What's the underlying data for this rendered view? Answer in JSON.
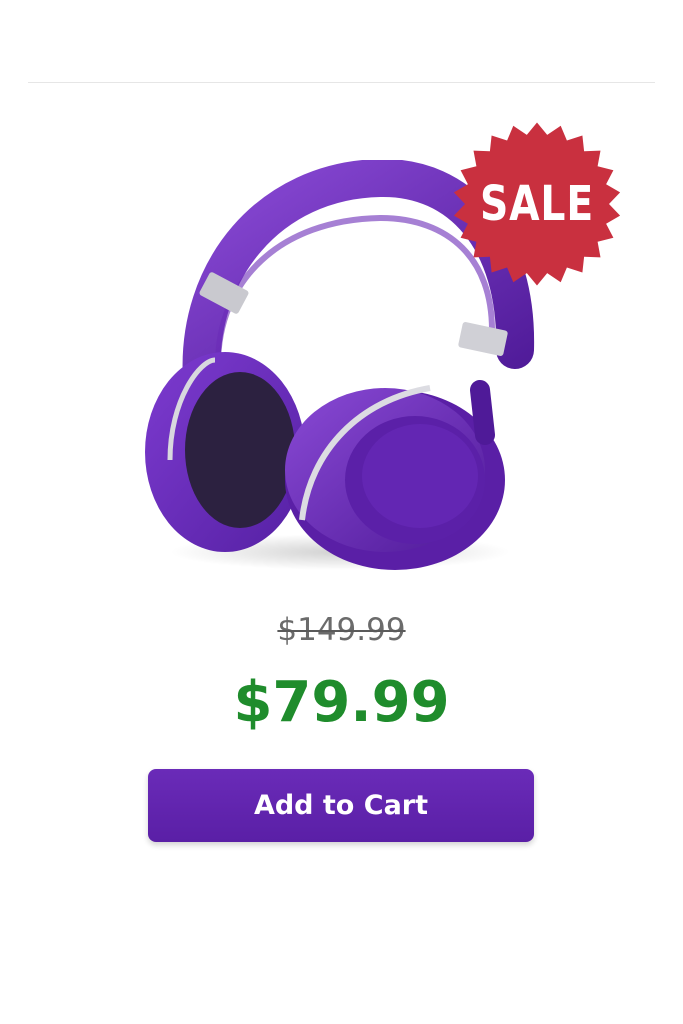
{
  "badge": {
    "label": "SALE",
    "color": "#c9303f"
  },
  "product": {
    "image_icon": "purple-headphones-icon",
    "color": "#6a2bb8"
  },
  "pricing": {
    "original_price": "$149.99",
    "sale_price": "$79.99",
    "sale_price_color": "#1f8c2c"
  },
  "actions": {
    "add_to_cart_label": "Add to Cart",
    "button_color": "#5f22aa"
  }
}
